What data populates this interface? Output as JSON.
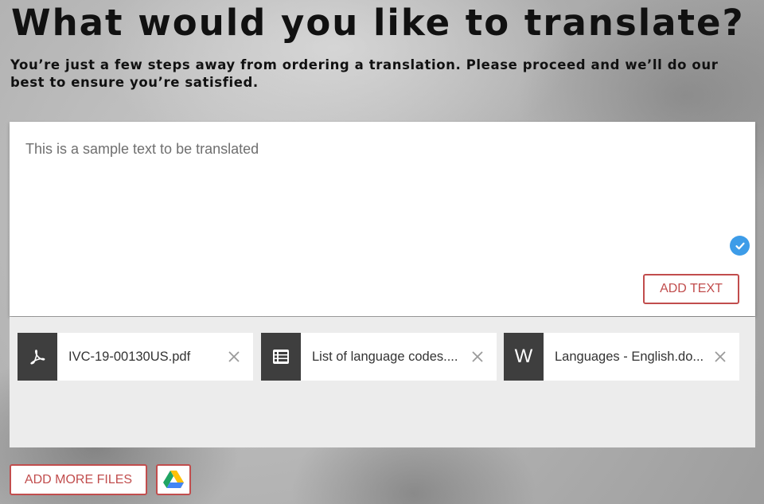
{
  "header": {
    "title": "What would you like to translate?",
    "subtitle": "You’re just a few steps away from ordering a translation. Please proceed and we’ll do our best to ensure you’re satisfied."
  },
  "text_input": {
    "value": "This is a sample text to be translated",
    "status_icon": "check-circle-icon",
    "add_button_label": "ADD TEXT"
  },
  "files": [
    {
      "name": "IVC-19-00130US.pdf",
      "icon": "pdf-icon"
    },
    {
      "name": "List of language codes....",
      "icon": "spreadsheet-icon"
    },
    {
      "name": "Languages - English.do...",
      "icon": "word-icon",
      "icon_letter": "W"
    }
  ],
  "actions": {
    "add_more_files_label": "ADD MORE FILES",
    "google_drive_icon": "google-drive-icon"
  },
  "colors": {
    "accent": "#c14d4d",
    "check_blue": "#3d9ce8",
    "file_icon_bg": "#3e3e3e"
  }
}
